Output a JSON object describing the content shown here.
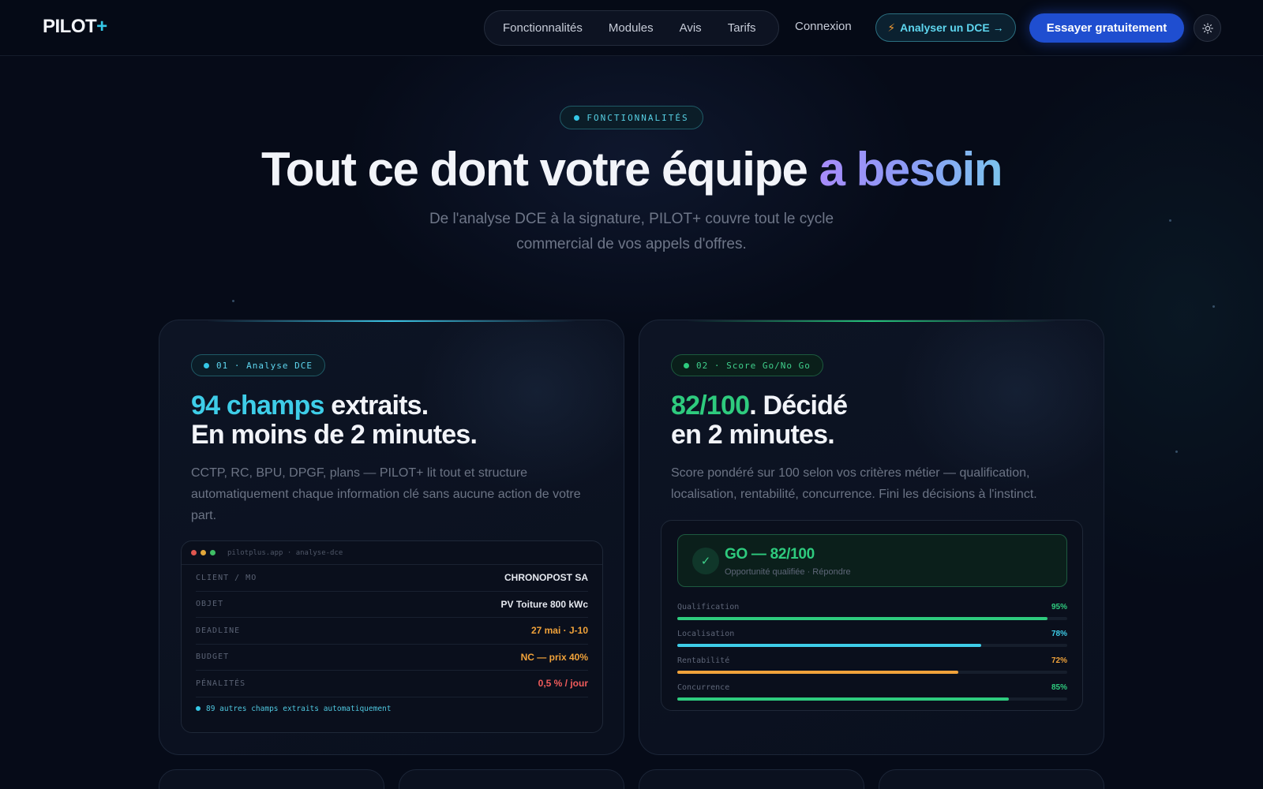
{
  "brand": {
    "name": "PILOT",
    "plus": "+"
  },
  "nav": {
    "links": [
      "Fonctionnalités",
      "Modules",
      "Avis",
      "Tarifs"
    ],
    "login": "Connexion",
    "analyse_btn": "Analyser un DCE →",
    "try_btn": "Essayer gratuitement",
    "theme_icon": "sun-icon"
  },
  "hero": {
    "badge": "FONCTIONNALITÉS",
    "title_main": "Tout ce dont votre équipe ",
    "title_accent": "a besoin",
    "subtitle": "De l'analyse DCE à la signature, PILOT+ couvre tout le cycle commercial de vos appels d'offres."
  },
  "cards": [
    {
      "tag": "01 · Analyse DCE",
      "title_hl": "94 champs",
      "title_rest1": " extraits.",
      "title_line2": "En moins de 2 minutes.",
      "desc": "CCTP, RC, BPU, DPGF, plans — PILOT+ lit tout et structure automatiquement chaque information clé sans aucune action de votre part.",
      "window": {
        "url": "pilotplus.app · analyse-dce",
        "rows": [
          {
            "key": "CLIENT / MO",
            "value": "CHRONOPOST SA",
            "color": "#e6e9f0"
          },
          {
            "key": "OBJET",
            "value": "PV Toiture 800 kWc",
            "color": "#e6e9f0"
          },
          {
            "key": "DEADLINE",
            "value": "27 mai · J-10",
            "color": "#f0a23a"
          },
          {
            "key": "BUDGET",
            "value": "NC — prix 40%",
            "color": "#f0a23a"
          },
          {
            "key": "PÉNALITÉS",
            "value": "0,5 % / jour",
            "color": "#ef5b5b"
          }
        ],
        "footer": "89 autres champs extraits automatiquement"
      }
    },
    {
      "tag": "02 · Score Go/No Go",
      "title_hl": "82/100",
      "title_rest1": ". Décidé",
      "title_line2": "en 2 minutes.",
      "desc": "Score pondéré sur 100 selon vos critères métier — qualification, localisation, rentabilité, concurrence. Fini les décisions à l'instinct.",
      "go": {
        "title": "GO — 82/100",
        "subtitle": "Opportunité qualifiée · Répondre",
        "icon": "check-icon"
      },
      "metrics": [
        {
          "label": "Qualification",
          "value": "95%",
          "pct": 95,
          "color": "#2ecb7e"
        },
        {
          "label": "Localisation",
          "value": "78%",
          "pct": 78,
          "color": "#3ecde8"
        },
        {
          "label": "Rentabilité",
          "value": "72%",
          "pct": 72,
          "color": "#f0a23a"
        },
        {
          "label": "Concurrence",
          "value": "85%",
          "pct": 85,
          "color": "#2ecb7e"
        }
      ]
    }
  ],
  "colors": {
    "accent": "#1f4ed0",
    "cyan": "#3ecde8",
    "green": "#2ecb7e",
    "orange": "#f0a23a",
    "red": "#ef5b5b"
  }
}
